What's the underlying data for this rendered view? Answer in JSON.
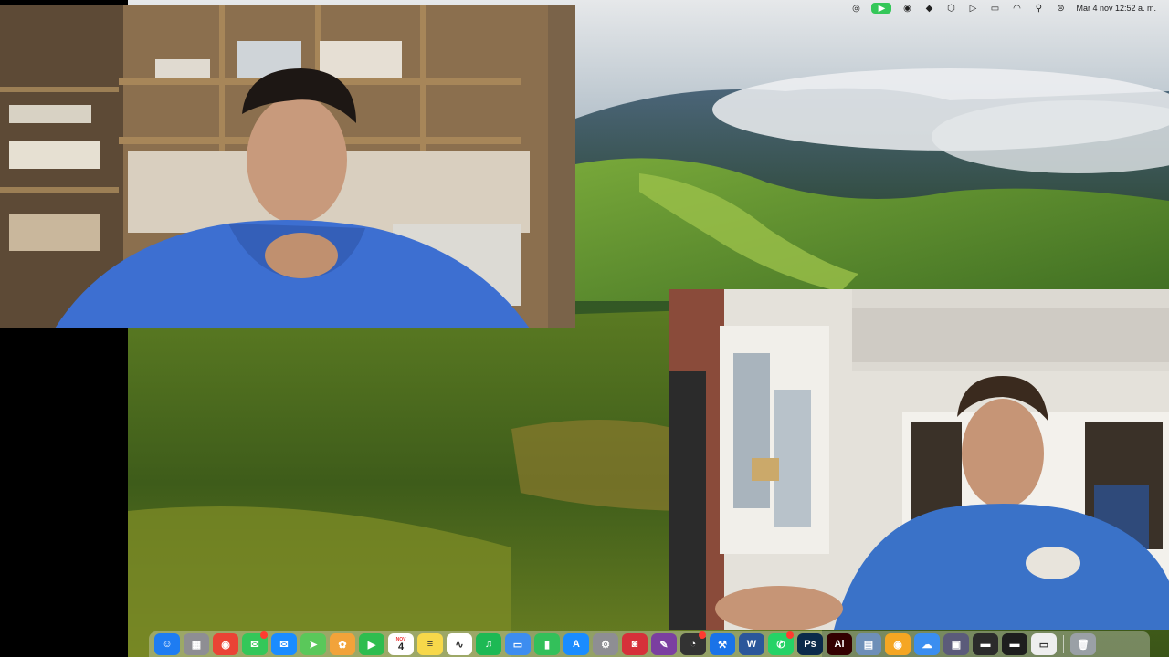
{
  "menubar": {
    "clock": "Mar 4 nov  12:52 a. m.",
    "icons": [
      "creative-cloud-icon",
      "facetime-active-icon",
      "record-icon",
      "dropbox-icon",
      "wacom-icon",
      "play-icon",
      "battery-icon",
      "wifi-icon",
      "spotlight-icon",
      "control-center-icon",
      "siri-icon"
    ]
  },
  "facetime": {
    "remote_video": "remote-participant-video",
    "local_video": "self-view-video"
  },
  "dock": {
    "calendar_month": "NOV",
    "calendar_day": "4",
    "apps": [
      {
        "name": "finder",
        "glyph": "☺",
        "color": "#1e7cf2"
      },
      {
        "name": "launchpad",
        "glyph": "▦",
        "color": "#8e8e93"
      },
      {
        "name": "chrome",
        "glyph": "◉",
        "color": "#ea4335"
      },
      {
        "name": "messages",
        "glyph": "✉",
        "color": "#34c759",
        "badge": true
      },
      {
        "name": "mail",
        "glyph": "✉",
        "color": "#1a8cff"
      },
      {
        "name": "maps",
        "glyph": "➤",
        "color": "#5ac85a"
      },
      {
        "name": "photos",
        "glyph": "✿",
        "color": "#f2a33a"
      },
      {
        "name": "facetime",
        "glyph": "▶",
        "color": "#2ebd4f"
      },
      {
        "name": "calendar",
        "glyph": "",
        "color": "#ffffff",
        "calendar": true
      },
      {
        "name": "notes",
        "glyph": "≡",
        "color": "#f7d84a"
      },
      {
        "name": "freeform",
        "glyph": "∿",
        "color": "#ffffff"
      },
      {
        "name": "spotify",
        "glyph": "♫",
        "color": "#1db954"
      },
      {
        "name": "keynote",
        "glyph": "▭",
        "color": "#3d8df0"
      },
      {
        "name": "numbers",
        "glyph": "▮",
        "color": "#33c05a"
      },
      {
        "name": "app-store",
        "glyph": "A",
        "color": "#1a8cff"
      },
      {
        "name": "system-settings",
        "glyph": "⚙",
        "color": "#8e8e93"
      },
      {
        "name": "photo-booth",
        "glyph": "◙",
        "color": "#d6303a"
      },
      {
        "name": "wacom",
        "glyph": "✎",
        "color": "#7b3fa0"
      },
      {
        "name": "activity-monitor",
        "glyph": "◔",
        "color": "#333333",
        "badge": true
      },
      {
        "name": "xcode-sim",
        "glyph": "⚒",
        "color": "#1a73e8"
      },
      {
        "name": "word",
        "glyph": "W",
        "color": "#2b579a"
      },
      {
        "name": "whatsapp",
        "glyph": "✆",
        "color": "#25d366",
        "badge": true
      },
      {
        "name": "photoshop",
        "glyph": "Ps",
        "color": "#0b2a4a"
      },
      {
        "name": "illustrator",
        "glyph": "Ai",
        "color": "#330000"
      },
      {
        "name": "preview",
        "glyph": "▤",
        "color": "#6e8fb8"
      },
      {
        "name": "chrome-canary",
        "glyph": "◉",
        "color": "#f5a623"
      },
      {
        "name": "weather",
        "glyph": "☁",
        "color": "#3b8ef0"
      },
      {
        "name": "screen-capture",
        "glyph": "▣",
        "color": "#5b5b7a"
      },
      {
        "name": "recent-app-1",
        "glyph": "▬",
        "color": "#2b2b2b"
      },
      {
        "name": "recent-app-2",
        "glyph": "▬",
        "color": "#1e1e1e"
      },
      {
        "name": "recent-app-3",
        "glyph": "▭",
        "color": "#eeeeee"
      },
      {
        "name": "trash",
        "glyph": "🗑",
        "color": "#9aa0a6"
      }
    ]
  }
}
